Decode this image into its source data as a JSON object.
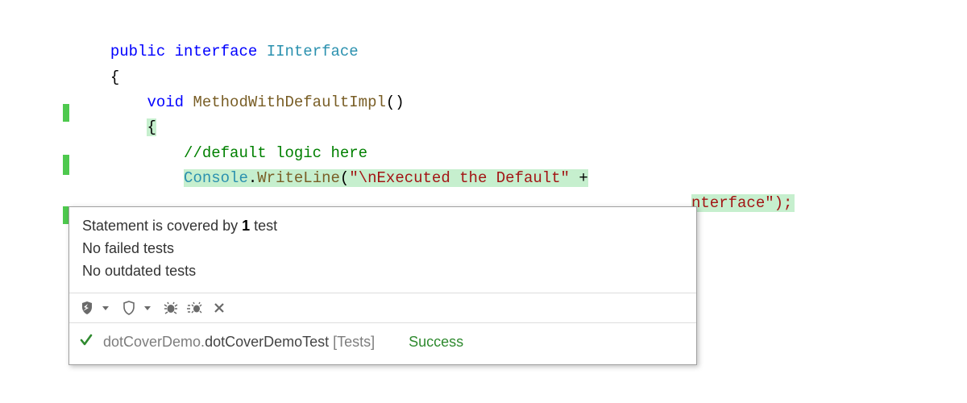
{
  "code": {
    "line1_public": "public",
    "line1_interface": "interface",
    "line1_type": "IInterface",
    "line2": "{",
    "line3_void": "void",
    "line3_method": "MethodWithDefaultImpl",
    "line3_paren": "()",
    "line4": "{",
    "line5_comment": "//default logic here",
    "line6_console": "Console",
    "line6_dot1": ".",
    "line6_writeline": "WriteLine",
    "line6_open": "(",
    "line6_str1": "\"\\nExecuted the Default\"",
    "line6_plus": " +",
    "line7_tail": "nterface\");"
  },
  "popup": {
    "line1_a": "Statement is covered by ",
    "line1_b": "1",
    "line1_c": " test",
    "line2": "No failed tests",
    "line3": "No outdated tests"
  },
  "footer": {
    "ns": "dotCoverDemo.",
    "cls": "dotCoverDemoTest",
    "suffix": " [Tests]",
    "status": "Success"
  }
}
